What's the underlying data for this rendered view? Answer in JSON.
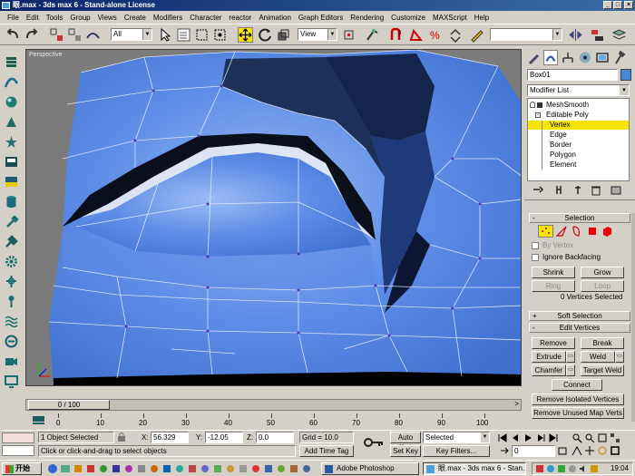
{
  "window": {
    "title": "眼.max - 3ds max 6 - Stand-alone License"
  },
  "menu": [
    "File",
    "Edit",
    "Tools",
    "Group",
    "Views",
    "Create",
    "Modifiers",
    "Character",
    "reactor",
    "Animation",
    "Graph Editors",
    "Rendering",
    "Customize",
    "MAXScript",
    "Help"
  ],
  "toolbar": {
    "selection_filter": "All",
    "ref_coord": "View",
    "named_selection": ""
  },
  "viewport": {
    "label": "Perspective"
  },
  "time": {
    "slider": "0 / 100",
    "ticks": [
      "0",
      "10",
      "20",
      "30",
      "40",
      "50",
      "60",
      "70",
      "80",
      "90",
      "100"
    ]
  },
  "panel": {
    "object_name": "Box01",
    "object_color": "#4a86d6",
    "modifier_list": "Modifier List",
    "stack": [
      {
        "label": "MeshSmooth",
        "level": 0
      },
      {
        "label": "Editable Poly",
        "level": 0
      },
      {
        "label": "Vertex",
        "level": 1,
        "selected": true
      },
      {
        "label": "Edge",
        "level": 1
      },
      {
        "label": "Border",
        "level": 1
      },
      {
        "label": "Polygon",
        "level": 1
      },
      {
        "label": "Element",
        "level": 1
      }
    ],
    "selection": {
      "title": "Selection",
      "by_vertex": "By Vertex",
      "ignore_backfacing": "Ignore Backfacing",
      "shrink": "Shrink",
      "grow": "Grow",
      "ring": "Ring",
      "loop": "Loop",
      "status": "0 Vertices Selected"
    },
    "soft_selection": "Soft Selection",
    "edit_vertices": {
      "title": "Edit Vertices",
      "remove": "Remove",
      "break": "Break",
      "extrude": "Extrude",
      "weld": "Weld",
      "chamfer": "Chamfer",
      "target_weld": "Target Weld",
      "connect": "Connect",
      "remove_isolated": "Remove Isolated Vertices",
      "remove_unused": "Remove Unused Map Verts"
    },
    "signs": {
      "plus": "+",
      "minus": "-"
    }
  },
  "status": {
    "selected": "1 Object Selected",
    "prompt": "Click or click-and-drag to select objects",
    "x_label": "X:",
    "x": "56.329",
    "y_label": "Y:",
    "y": "-12.05",
    "z_label": "Z:",
    "z": "0.0",
    "grid": "Grid = 10.0",
    "add_time_tag": "Add Time Tag",
    "auto_key": "Auto Key",
    "set_key": "Set Key",
    "key_mode": "Selected",
    "key_filters": "Key Filters...",
    "frame": "0"
  },
  "taskbar": {
    "start": "开始",
    "tasks": [
      "Adobe Photoshop",
      "眼.max - 3ds max 6 - Stan..."
    ],
    "clock": "19:04"
  }
}
